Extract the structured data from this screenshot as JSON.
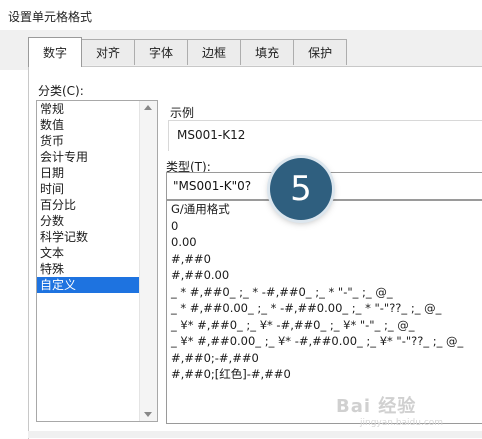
{
  "window": {
    "title": "设置单元格格式"
  },
  "tabs": [
    {
      "label": "数字",
      "active": true
    },
    {
      "label": "对齐",
      "active": false
    },
    {
      "label": "字体",
      "active": false
    },
    {
      "label": "边框",
      "active": false
    },
    {
      "label": "填充",
      "active": false
    },
    {
      "label": "保护",
      "active": false
    }
  ],
  "category": {
    "label": "分类(C):",
    "items": [
      "常规",
      "数值",
      "货币",
      "会计专用",
      "日期",
      "时间",
      "百分比",
      "分数",
      "科学记数",
      "文本",
      "特殊",
      "自定义"
    ],
    "selected_index": 11
  },
  "sample": {
    "label": "示例",
    "value": "MS001-K12"
  },
  "type": {
    "label": "类型(T):",
    "value": "\"MS001-K\"0?"
  },
  "formats": [
    "G/通用格式",
    "0",
    "0.00",
    "#,##0",
    "#,##0.00",
    "_ * #,##0_ ;_ * -#,##0_ ;_ * \"-\"_ ;_ @_",
    "_ * #,##0.00_ ;_ * -#,##0.00_ ;_ * \"-\"??_ ;_ @_",
    "_ ¥* #,##0_ ;_ ¥* -#,##0_ ;_ ¥* \"-\"_ ;_ @_",
    "_ ¥* #,##0.00_ ;_ ¥* -#,##0.00_ ;_ ¥* \"-\"??_ ;_ @_",
    "#,##0;-#,##0",
    "#,##0;[红色]-#,##0"
  ],
  "annotation": {
    "step": "5"
  },
  "watermark": {
    "text": "Bai 经验",
    "url": "jingyan.baidu.com"
  },
  "colors": {
    "selection": "#1e73e0",
    "badge": "#2f5f7f"
  }
}
